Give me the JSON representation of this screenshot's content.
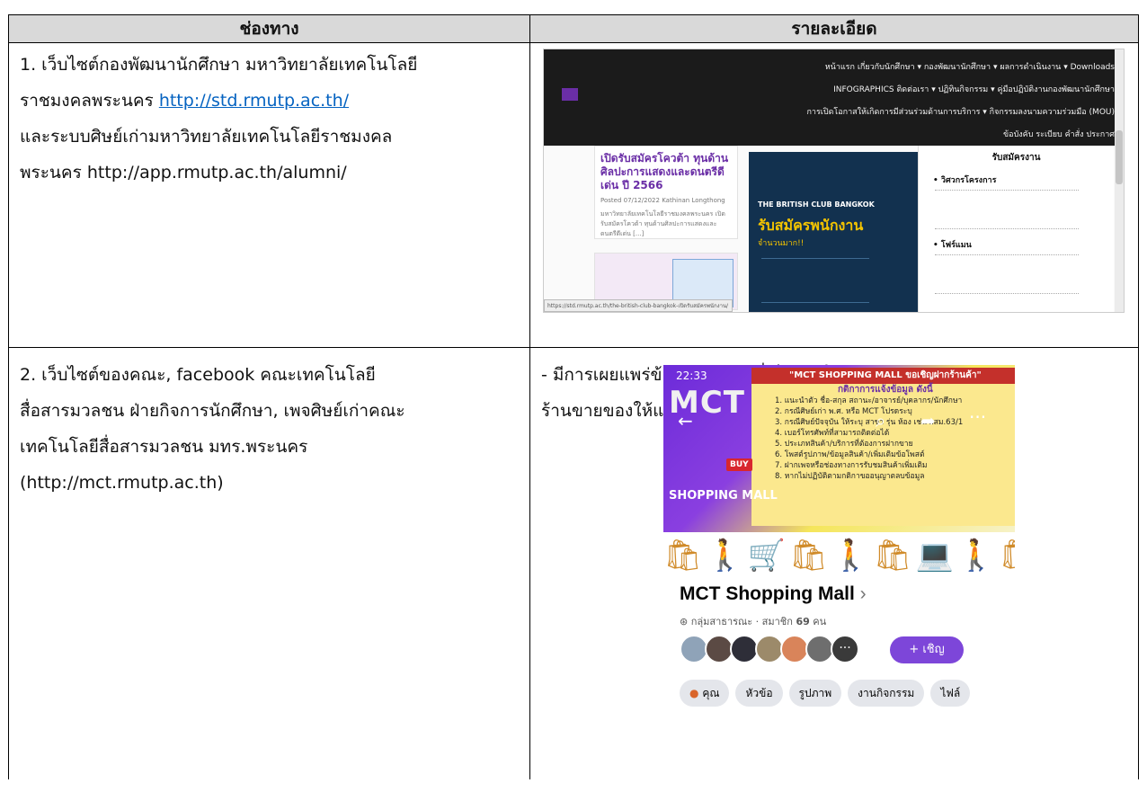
{
  "table": {
    "headers": [
      "ช่องทาง",
      "รายละเอียด"
    ],
    "rows": [
      {
        "channel_lines": [
          "1. เว็บไซต์กองพัฒนานักศึกษา มหาวิทยาลัยเทคโนโลยี",
          "ราชมงคลพระนคร ",
          "และระบบศิษย์เก่ามหาวิทยาลัยเทคโนโลยีราชมงคล",
          "พระนคร  http://app.rmutp.ac.th/alumni/"
        ],
        "channel_link": "http://std.rmutp.ac.th/"
      },
      {
        "channel_lines": [
          "2. เว็บไซต์ของคณะ, facebook คณะเทคโนโลยี",
          "สื่อสารมวลชน ฝ่ายกิจการนักศึกษา, เพจศิษย์เก่าคณะ",
          "เทคโนโลยีสื่อสารมวลชน มทร.พระนคร",
          "(http://mct.rmutp.ac.th)"
        ],
        "detail_lines": [
          "- มีการเผยแพร่ข้อมูลข่าวสารที่เป็นประโยชน์ต่อศิษย์เก่า เช่น ฝาก",
          "ร้านขายของให้แก่ศิษย์เก่า ในเพจ MCT Shopping Mall"
        ]
      }
    ]
  },
  "screenshot1": {
    "nav_rows": [
      "หน้าแรก  เกี่ยวกับนักศึกษา ▾  กองพัฒนานักศึกษา ▾  ผลการดำเนินงาน ▾  Downloads",
      "INFOGRAPHICS  ติดต่อเรา ▾  ปฏิทินกิจกรรม ▾  คู่มือปฏิบัติงานกองพัฒนานักศึกษา",
      "การเปิดโอกาสให้เกิดการมีส่วนร่วมด้านการบริการ ▾  กิจกรรมลงนามความร่วมมือ (MOU)",
      "ข้อบังคับ ระเบียบ คำสั่ง ประกาศ"
    ],
    "post_title": "เปิดรับสมัครโควต้า ทุนด้านศิลปะการแสดงและดนตรีดีเด่น ปี 2566",
    "post_meta": "Posted 07/12/2022   Kathinan Longthong",
    "post_excerpt": "มหาวิทยาลัยเทคโนโลยีราชมงคลพระนคร เปิดรับสมัครโควต้า ทุนด้านศิลปะการแสดงและดนตรีดีเด่น [...]",
    "poster_club": "THE BRITISH CLUB BANGKOK",
    "poster_headline": "รับสมัครพนักงาน",
    "poster_sub": "จำนวนมาก!!",
    "doc_title": "รับสมัครงาน",
    "doc_items": [
      "วิศวกรโครงการ",
      "โฟร์แมน"
    ],
    "status_url": "https://std.rmutp.ac.th/the-british-club-bangkok-เปิดรับสมัครพนักงาน/"
  },
  "screenshot2": {
    "time": "22:33",
    "banner_head": "\"MCT SHOPPING MALL ขอเชิญฝากร้านค้า\"",
    "rules_head": "กติกาการแจ้งข้อมูล ดังนี้",
    "rules": [
      "1. แนะนำตัว ชื่อ-สกุล สถานะ/อาจารย์/บุคลากร/นักศึกษา",
      "2. กรณีศิษย์เก่า พ.ศ. หรือ MCT โปรดระบุ",
      "3. กรณีศิษย์ปัจจุบัน ให้ระบุ สาขา รุ่น ห้อง เช่น ผสม.63/1",
      "4. เบอร์โทรศัพท์ที่สามารถติดต่อได้",
      "5. ประเภทสินค้า/บริการที่ต้องการฝากขาย",
      "6. โพสต์รูปภาพ/ข้อมูลสินค้า/เพิ่มเติมข้อโพสต์",
      "7. ฝากเพจหรือช่องทางการรับชมสินค้าเพิ่มเติม",
      "8. หากไม่ปฏิบัติตามกติกาขออนุญาตลบข้อมูล"
    ],
    "logo": "MCT",
    "buy": "BUY",
    "mall_label": "SHOPPING MALL",
    "group_name": "MCT Shopping Mall",
    "group_meta_prefix": "กลุ่มสาธารณะ · สมาชิก ",
    "member_count": "69",
    "group_meta_suffix": " คน",
    "invite": "+ เชิญ",
    "chips": [
      "คุณ",
      "หัวข้อ",
      "รูปภาพ",
      "งานกิจกรรม",
      "ไฟล์"
    ]
  }
}
